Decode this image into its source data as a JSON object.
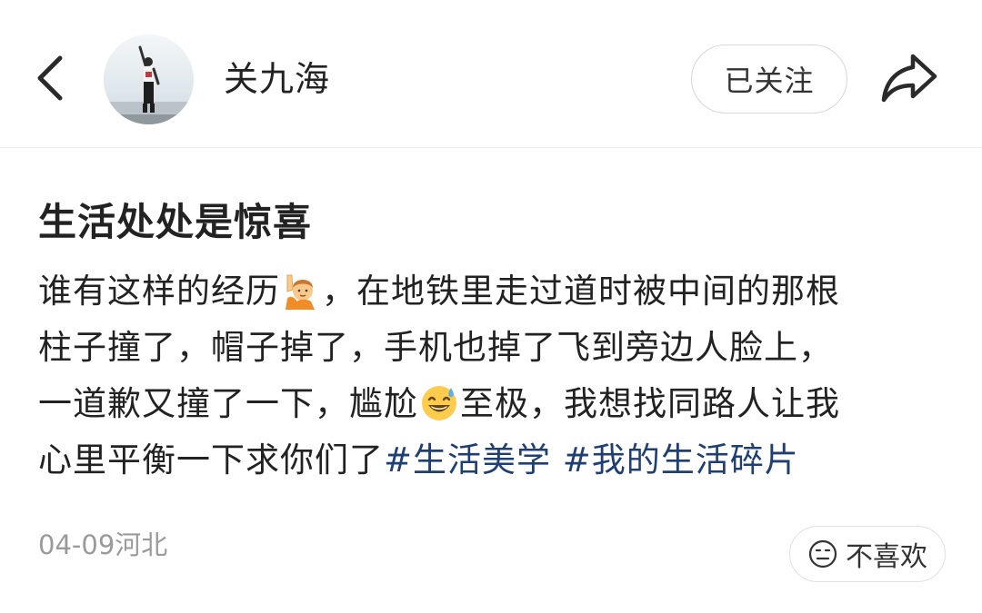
{
  "header": {
    "back_icon": "chevron-left-icon",
    "username": "关九海",
    "follow_label": "已关注",
    "share_icon": "share-arrow-icon"
  },
  "post": {
    "title": "生活处处是惊喜",
    "body": {
      "line1_a": "谁有这样的经历",
      "line1_emoji": "raising-hand-emoji",
      "line1_b": "，在地铁里走过道时被中间的那根",
      "line2": "柱子撞了，帽子掉了，手机也掉了飞到旁边人脸上，",
      "line3_a": "一道歉又撞了一下，尴尬",
      "line3_emoji": "sweat-smile-emoji",
      "line3_b": "至极，我想找同路人让我",
      "line4_a": "心里平衡一下求你们了",
      "hashtag1": "#生活美学",
      "hashtag2": "#我的生活碎片"
    },
    "meta": "04-09河北",
    "dislike_label": "不喜欢",
    "dislike_icon": "neutral-face-icon"
  },
  "colors": {
    "hashtag": "#1f3f73",
    "meta_text": "#9a9a9a",
    "divider": "#ececec"
  }
}
